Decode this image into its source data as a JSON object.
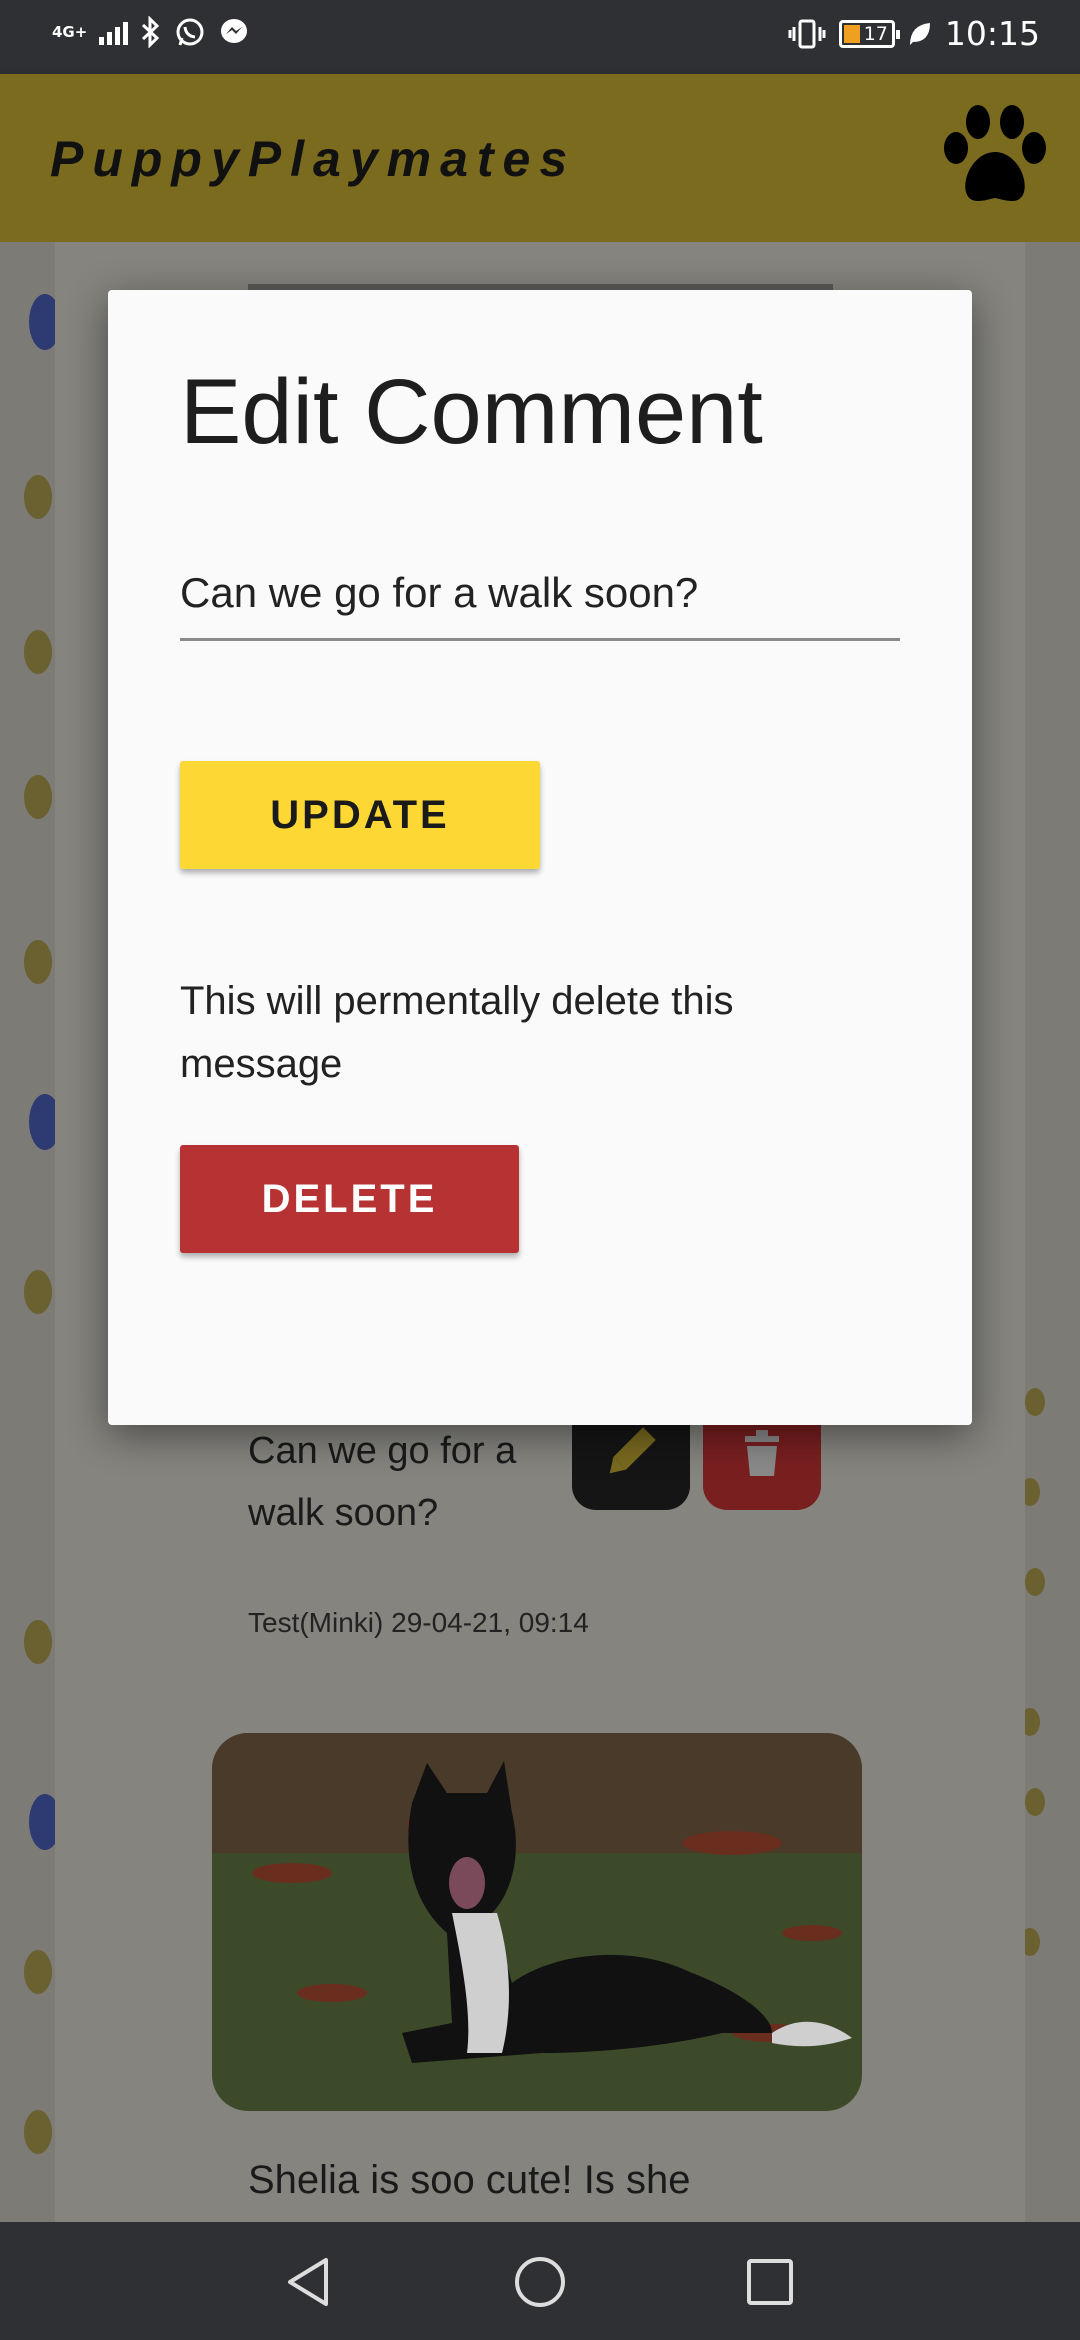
{
  "status_bar": {
    "network_label": "4G+",
    "battery_level": "17",
    "time": "10:15",
    "icons": [
      "signal-icon",
      "bluetooth-icon",
      "whatsapp-icon",
      "messenger-icon",
      "vibrate-icon",
      "battery-icon",
      "leaf-icon"
    ]
  },
  "app_bar": {
    "title": "PuppyPlaymates",
    "logo_icon": "paw-icon",
    "background_color": "#c8a82a"
  },
  "feed": {
    "comment_text": "Can we go for a walk soon?",
    "comment_meta": "Test(Minki) 29-04-21, 09:14",
    "edit_icon": "pencil-icon",
    "delete_icon": "trash-icon",
    "next_comment_text": "Shelia is soo cute! Is she"
  },
  "modal": {
    "title": "Edit Comment",
    "comment_value": "Can we go for a walk soon?",
    "update_label": "UPDATE",
    "warning_text": "This will permentally delete this message",
    "delete_label": "DELETE",
    "update_color": "#fdd835",
    "delete_color": "#b73232"
  },
  "nav_bar": {
    "buttons": [
      "back-icon",
      "home-icon",
      "recents-icon"
    ]
  }
}
